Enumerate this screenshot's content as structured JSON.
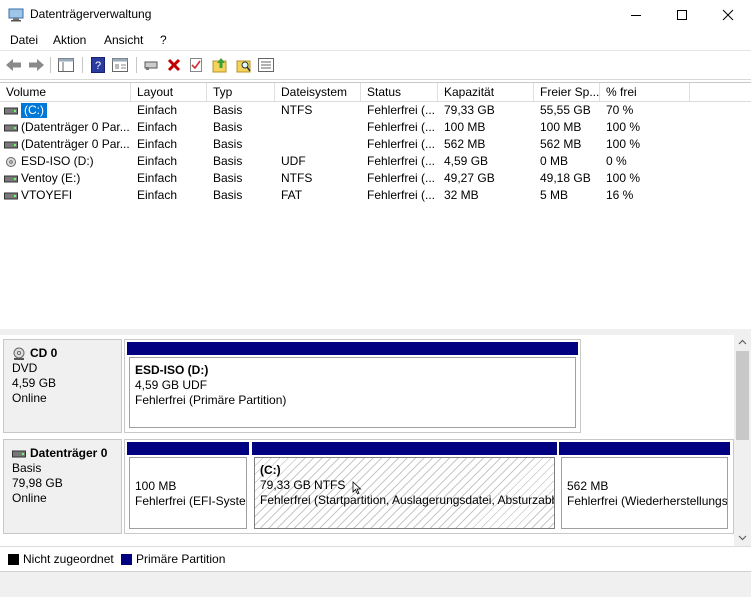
{
  "window": {
    "title": "Datenträgerverwaltung"
  },
  "menu": [
    "Datei",
    "Aktion",
    "Ansicht",
    "?"
  ],
  "toolbar": [
    "back-icon",
    "forward-icon",
    "console-tree-icon",
    "help-icon",
    "properties-icon",
    "connect-icon",
    "delete-icon",
    "check-icon",
    "folder-up-icon",
    "search-folder-icon",
    "list-icon"
  ],
  "colors": {
    "primary_partition": "#000080",
    "unallocated": "#000000",
    "selection": "#0078d7"
  },
  "columns": [
    "Volume",
    "Layout",
    "Typ",
    "Dateisystem",
    "Status",
    "Kapazität",
    "Freier Sp...",
    "% frei"
  ],
  "volumes": [
    {
      "name": "(C:)",
      "layout": "Einfach",
      "type": "Basis",
      "fs": "NTFS",
      "status": "Fehlerfrei (...",
      "capacity": "79,33 GB",
      "free": "55,55 GB",
      "pct": "70 %",
      "icon": "volume-icon",
      "selected": true
    },
    {
      "name": "(Datenträger 0 Par...",
      "layout": "Einfach",
      "type": "Basis",
      "fs": "",
      "status": "Fehlerfrei (...",
      "capacity": "100 MB",
      "free": "100 MB",
      "pct": "100 %",
      "icon": "volume-icon"
    },
    {
      "name": "(Datenträger 0 Par...",
      "layout": "Einfach",
      "type": "Basis",
      "fs": "",
      "status": "Fehlerfrei (...",
      "capacity": "562 MB",
      "free": "562 MB",
      "pct": "100 %",
      "icon": "volume-icon"
    },
    {
      "name": "ESD-ISO (D:)",
      "layout": "Einfach",
      "type": "Basis",
      "fs": "UDF",
      "status": "Fehlerfrei (...",
      "capacity": "4,59 GB",
      "free": "0 MB",
      "pct": "0 %",
      "icon": "cd-icon"
    },
    {
      "name": "Ventoy (E:)",
      "layout": "Einfach",
      "type": "Basis",
      "fs": "NTFS",
      "status": "Fehlerfrei (...",
      "capacity": "49,27 GB",
      "free": "49,18 GB",
      "pct": "100 %",
      "icon": "volume-icon"
    },
    {
      "name": "VTOYEFI",
      "layout": "Einfach",
      "type": "Basis",
      "fs": "FAT",
      "status": "Fehlerfrei (...",
      "capacity": "32 MB",
      "free": "5 MB",
      "pct": "16 %",
      "icon": "volume-icon"
    }
  ],
  "disks": {
    "cd0": {
      "name": "CD 0",
      "type": "DVD",
      "size": "4,59 GB",
      "state": "Online",
      "partition": {
        "title": "ESD-ISO  (D:)",
        "size": "4,59 GB UDF",
        "status": "Fehlerfrei (Primäre Partition)"
      }
    },
    "disk0": {
      "name": "Datenträger 0",
      "type": "Basis",
      "size": "79,98 GB",
      "state": "Online",
      "partitions": [
        {
          "size": "100 MB",
          "status": "Fehlerfrei (EFI-Systempartition)"
        },
        {
          "title": "(C:)",
          "size": "79,33 GB NTFS",
          "status": "Fehlerfrei (Startpartition, Auslagerungsdatei, Absturzabbild, Primäre Partition)"
        },
        {
          "size": "562 MB",
          "status": "Fehlerfrei (Wiederherstellungspartition)"
        }
      ]
    }
  },
  "legend": {
    "unallocated": "Nicht zugeordnet",
    "primary": "Primäre Partition"
  }
}
